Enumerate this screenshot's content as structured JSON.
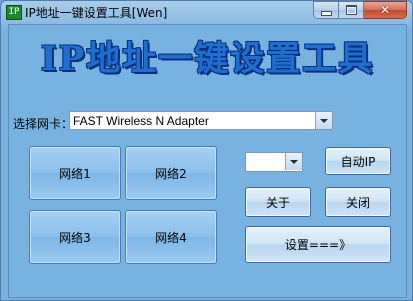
{
  "window": {
    "title": "IP地址一键设置工具[Wen]",
    "app_icon_glyph": "IP"
  },
  "banner": {
    "text": "IP地址一键设置工具"
  },
  "nic": {
    "label": "选择网卡：",
    "selected": "FAST Wireless N Adapter"
  },
  "networks": {
    "net1": "网络1",
    "net2": "网络2",
    "net3": "网络3",
    "net4": "网络4"
  },
  "right_panel": {
    "auto_ip": "自动IP",
    "about": "关于",
    "close": "关闭",
    "settings": "设置===》"
  },
  "colors": {
    "banner": "#1e6fd0",
    "client_bg": "#77b2e0"
  }
}
